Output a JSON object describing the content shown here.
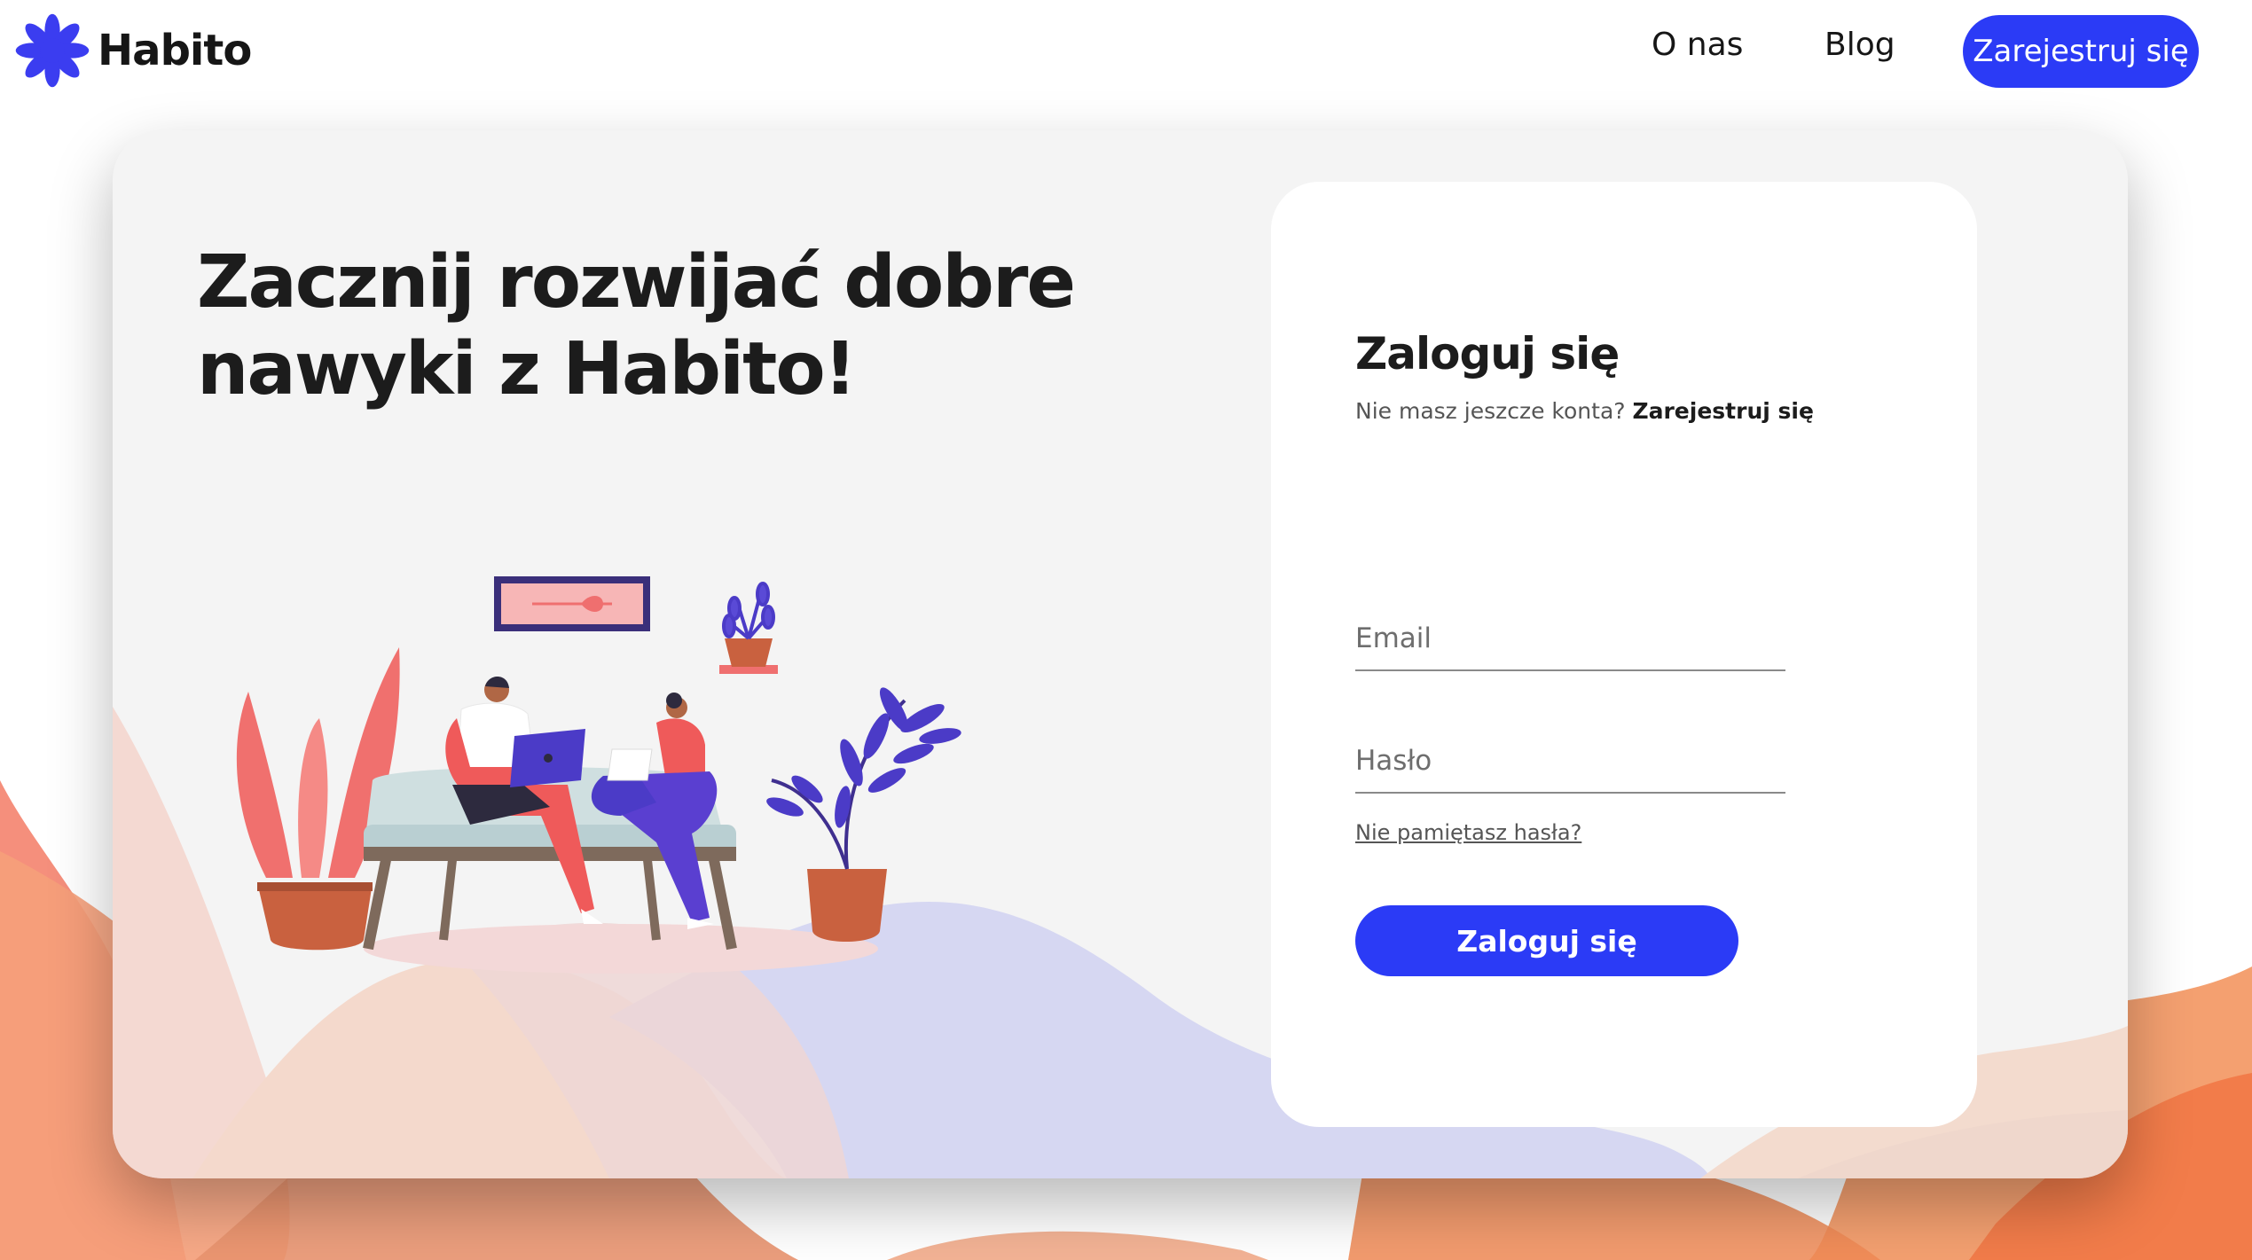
{
  "brand": {
    "name": "Habito",
    "icon": "flower-logo-icon",
    "accent_color": "#2b3bf6"
  },
  "nav": {
    "about": "O nas",
    "blog": "Blog",
    "register": "Zarejestruj się"
  },
  "hero": {
    "headline_line1": "Zacznij rozwijać dobre",
    "headline_line2": "nawyki z Habito!"
  },
  "login": {
    "title": "Zaloguj się",
    "no_account_text": "Nie masz jeszcze konta?",
    "register_link": "Zarejestruj się",
    "email_placeholder": "Email",
    "password_placeholder": "Hasło",
    "forgot_password": "Nie pamiętasz hasła?",
    "submit": "Zaloguj się"
  },
  "colors": {
    "wave_orange": "#f7a26b",
    "wave_salmon": "#f28a7d",
    "wave_purple": "#8d92ee"
  }
}
